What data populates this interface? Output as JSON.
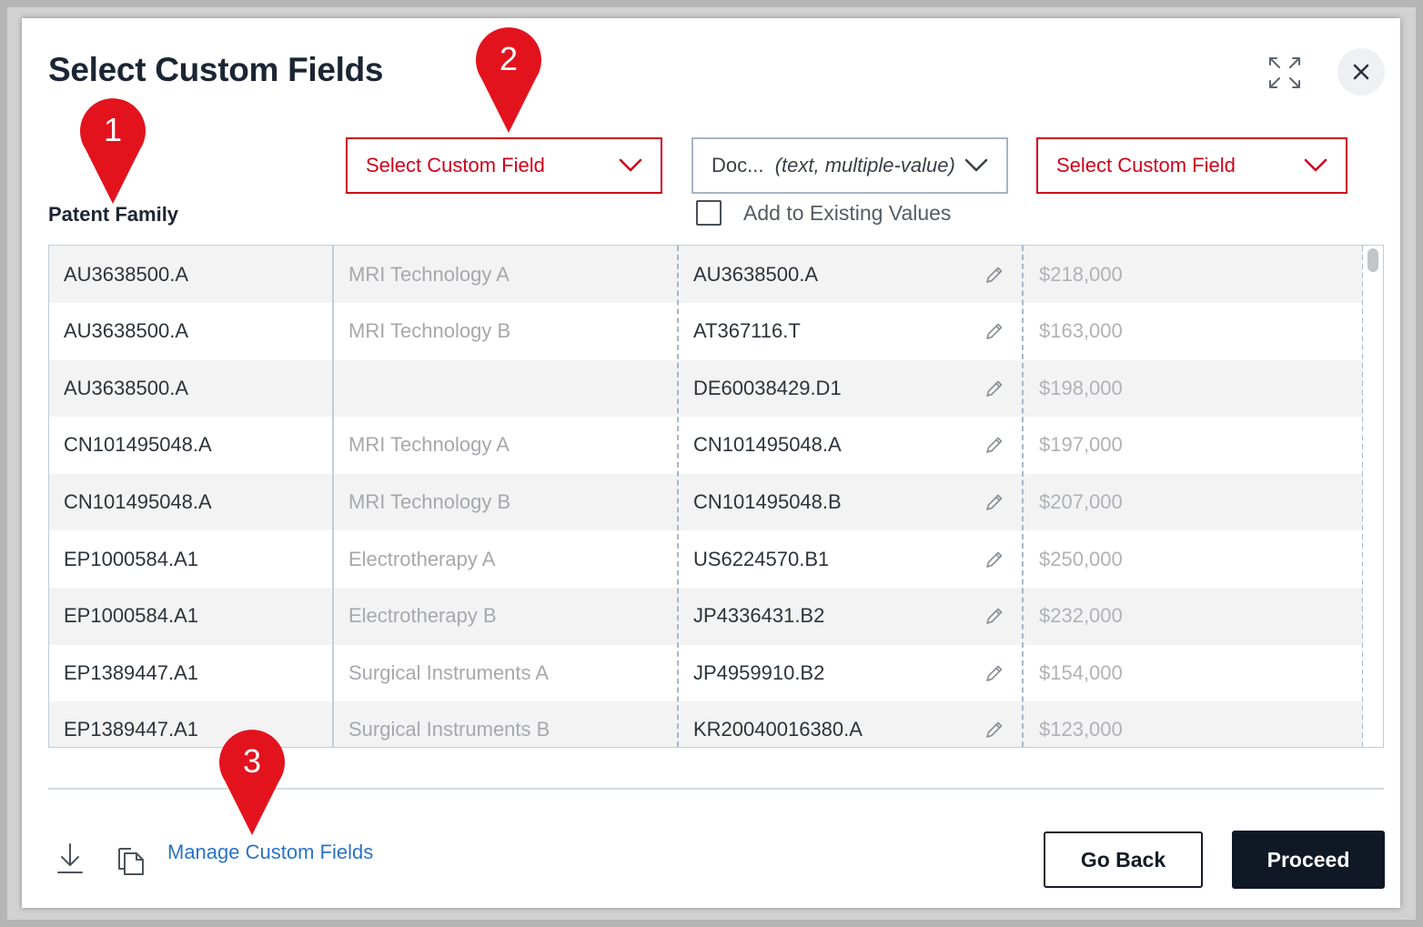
{
  "dialog": {
    "title": "Select Custom Fields"
  },
  "icons": {
    "expand": "expand-icon",
    "close": "close-icon",
    "download": "download-icon",
    "copy": "copy-icon",
    "edit": "pencil-icon",
    "dropdown": "chevron-down-icon"
  },
  "columns": {
    "first_label": "Patent Family",
    "select_1": {
      "label": "Select Custom Field",
      "state": "error"
    },
    "select_2": {
      "label": "Doc...",
      "hint": "(text, multiple-value)",
      "state": "normal"
    },
    "select_3": {
      "label": "Select Custom Field",
      "state": "error"
    },
    "add_existing_label": "Add to Existing Values",
    "add_existing_checked": false
  },
  "rows": [
    {
      "family": "AU3638500.A",
      "field1": "MRI Technology A",
      "doc": "AU3638500.A",
      "value": "$218,000"
    },
    {
      "family": "AU3638500.A",
      "field1": "MRI Technology B",
      "doc": "AT367116.T",
      "value": "$163,000"
    },
    {
      "family": "AU3638500.A",
      "field1": "",
      "doc": "DE60038429.D1",
      "value": "$198,000"
    },
    {
      "family": "CN101495048.A",
      "field1": "MRI Technology A",
      "doc": "CN101495048.A",
      "value": "$197,000"
    },
    {
      "family": "CN101495048.A",
      "field1": "MRI Technology B",
      "doc": "CN101495048.B",
      "value": "$207,000"
    },
    {
      "family": "EP1000584.A1",
      "field1": "Electrotherapy A",
      "doc": "US6224570.B1",
      "value": "$250,000"
    },
    {
      "family": "EP1000584.A1",
      "field1": "Electrotherapy B",
      "doc": "JP4336431.B2",
      "value": "$232,000"
    },
    {
      "family": "EP1389447.A1",
      "field1": "Surgical Instruments A",
      "doc": "JP4959910.B2",
      "value": "$154,000"
    },
    {
      "family": "EP1389447.A1",
      "field1": "Surgical Instruments B",
      "doc": "KR20040016380.A",
      "value": "$123,000"
    }
  ],
  "footer": {
    "manage_link": "Manage Custom Fields",
    "go_back": "Go Back",
    "proceed": "Proceed"
  },
  "callouts": [
    "1",
    "2",
    "3"
  ],
  "colors": {
    "accent_error": "#d0021b",
    "callout_red": "#e3131e",
    "primary_button": "#101826",
    "link": "#2a74c4"
  }
}
